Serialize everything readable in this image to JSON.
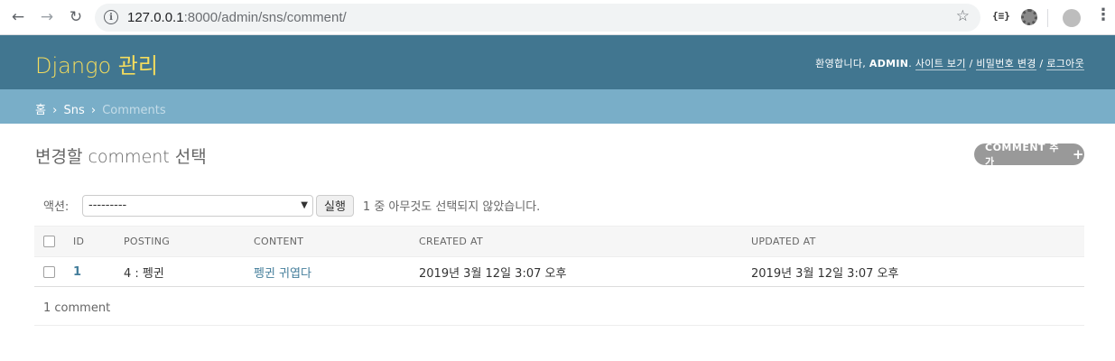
{
  "browser": {
    "url_host": "127.0.0.1",
    "url_rest": ":8000/admin/sns/comment/",
    "extension_label": "{≡}"
  },
  "header": {
    "branding": "Django 관리",
    "welcome": "환영합니다,",
    "username": "ADMIN",
    "view_site": "사이트 보기",
    "change_password": "비밀번호 변경",
    "logout": "로그아웃",
    "separator": "/"
  },
  "breadcrumbs": {
    "home": "홈",
    "app": "Sns",
    "current": "Comments",
    "separator": "›"
  },
  "page": {
    "title": "변경할 comment 선택",
    "add_button": "COMMENT 추가",
    "add_icon": "+"
  },
  "actions": {
    "label": "액션:",
    "selected": "---------",
    "go_button": "실행",
    "counter": "1 중 아무것도 선택되지 않았습니다."
  },
  "table": {
    "headers": [
      "ID",
      "POSTING",
      "CONTENT",
      "CREATED AT",
      "UPDATED AT"
    ],
    "rows": [
      {
        "id": "1",
        "posting": "4 : 펭귄",
        "content": "펭귄 귀엽다",
        "created_at": "2019년 3월 12일 3:07 오후",
        "updated_at": "2019년 3월 12일 3:07 오후"
      }
    ]
  },
  "paginator": "1 comment"
}
